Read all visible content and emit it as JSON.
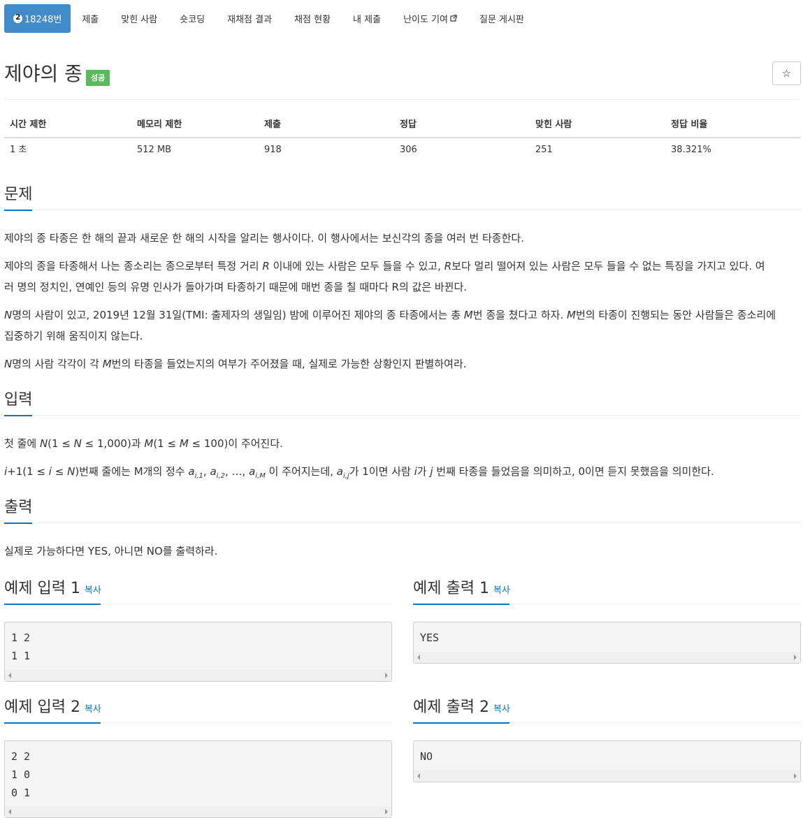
{
  "nav": {
    "problem_id": "18248번",
    "items": [
      "제출",
      "맞힌 사람",
      "숏코딩",
      "재채점 결과",
      "채점 현황",
      "내 제출",
      "난이도 기여",
      "질문 게시판"
    ]
  },
  "problem": {
    "title": "제야의 종",
    "badge": "성공"
  },
  "info": {
    "headers": [
      "시간 제한",
      "메모리 제한",
      "제출",
      "정답",
      "맞힌 사람",
      "정답 비율"
    ],
    "values": [
      "1 초",
      "512 MB",
      "918",
      "306",
      "251",
      "38.321%"
    ]
  },
  "sections": {
    "problem": {
      "title": "문제",
      "p1": "제야의 종 타종은 한 해의 끝과 새로운 한 해의 시작을 알리는 행사이다. 이 행사에서는 보신각의 종을 여러 번 타종한다.",
      "p2a": "제야의 종을 타종해서 나는 종소리는 종으로부터 특정 거리 ",
      "p2b": " 이내에 있는 사람은 모두 들을 수 있고, ",
      "p2c": "보다 멀리 떨어져 있는 사람은 모두 들을 수 없는 특징을 가지고 있다. 여",
      "p2d": "러 명의 정치인, 연예인 등의 유명 인사가 돌아가며 타종하기 때문에 매번 종을 칠 때마다 R의 값은 바뀐다.",
      "p3a": "명의 사람이 있고, 2019년 12월 31일(TMI: 출제자의 생일임) 밤에 이루어진 제야의 종 타종에서는 총 ",
      "p3b": "번 종을 쳤다고 하자. ",
      "p3c": "번의 타종이 진행되는 동안 사람들은 종소리에",
      "p3d": "집중하기 위해 움직이지 않는다.",
      "p4a": "명의 사람 각각이 각 ",
      "p4b": "번의 타종을 들었는지의 여부가 주어졌을 때, 실제로 가능한 상황인지 판별하여라."
    },
    "input": {
      "title": "입력",
      "p1a": "첫 줄에 ",
      "p1b": "(1 ≤ ",
      "p1c": " ≤ 1,000)과 ",
      "p1d": "(1 ≤ ",
      "p1e": " ≤ 100)이 주어진다.",
      "p2a": "+1(1 ≤ ",
      "p2b": " ≤ ",
      "p2c": ")번째 줄에는 M개의 정수 ",
      "p2d": " 이 주어지는데, ",
      "p2e": "가 1이면 사람 ",
      "p2f": "가 ",
      "p2g": " 번째 타종을 들었음을 의미하고, 0이면 듣지 못했음을 의미한다."
    },
    "output": {
      "title": "출력",
      "p1": "실제로 가능하다면 YES, 아니면 NO를 출력하라."
    },
    "math": {
      "R": "R",
      "N": "N",
      "M": "M",
      "i": "i",
      "j": "j",
      "a": "a",
      "sub_i1": "i,1",
      "sub_i2": "i,2",
      "sub_iM": "i,M",
      "sub_ij": "i,j",
      "ellipsis": "…"
    }
  },
  "samples": {
    "copy_label": "복사",
    "in1_title": "예제 입력 1",
    "out1_title": "예제 출력 1",
    "in2_title": "예제 입력 2",
    "out2_title": "예제 출력 2",
    "in1": "1 2\n1 1",
    "out1": "YES",
    "in2": "2 2\n1 0\n0 1",
    "out2": "NO"
  }
}
